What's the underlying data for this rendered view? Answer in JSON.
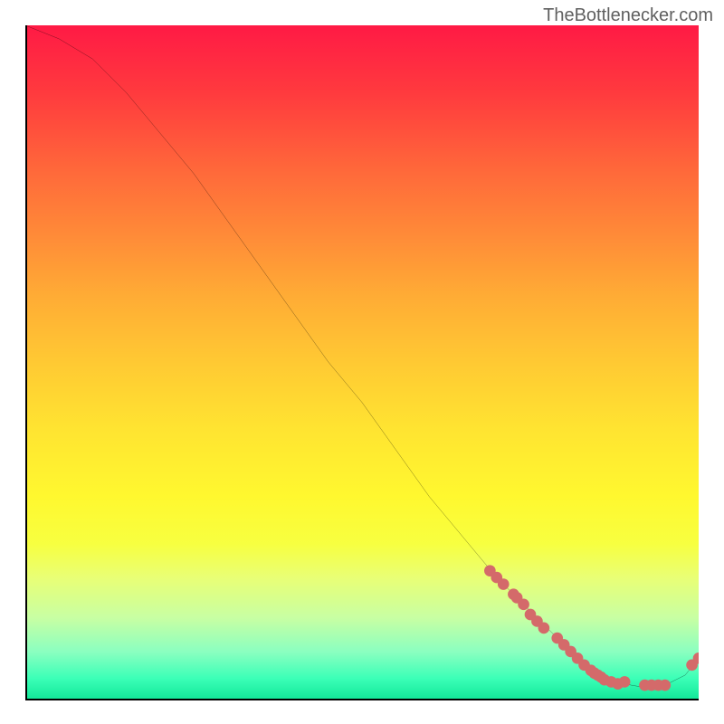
{
  "watermark": "TheBottlenecker.com",
  "chart_data": {
    "type": "line",
    "title": "",
    "xlabel": "",
    "ylabel": "",
    "xlim": [
      0,
      100
    ],
    "ylim": [
      0,
      100
    ],
    "series": [
      {
        "name": "curve",
        "x": [
          0,
          5,
          10,
          15,
          20,
          25,
          30,
          35,
          40,
          45,
          50,
          55,
          60,
          65,
          70,
          75,
          80,
          83,
          85,
          88,
          90,
          93,
          95,
          98,
          100
        ],
        "y": [
          100,
          98,
          95,
          90,
          84,
          78,
          71,
          64,
          57,
          50,
          44,
          37,
          30,
          24,
          18,
          13,
          8,
          5,
          4,
          2.5,
          2,
          1.5,
          2,
          3.5,
          6
        ]
      }
    ],
    "points": {
      "name": "markers",
      "color": "#d46a6a",
      "x": [
        69,
        70,
        71,
        72.5,
        73,
        74,
        75,
        76,
        77,
        79,
        80,
        81,
        82,
        83,
        84,
        84.5,
        85,
        85.5,
        86,
        87,
        88,
        89,
        92,
        93,
        94,
        95,
        99,
        100
      ],
      "y": [
        19,
        18,
        17,
        15.5,
        15,
        14,
        12.5,
        11.5,
        10.5,
        9,
        8,
        7,
        6,
        5,
        4.2,
        3.8,
        3.5,
        3.2,
        2.8,
        2.5,
        2.2,
        2.5,
        2,
        2,
        2,
        2,
        5,
        6
      ]
    }
  }
}
